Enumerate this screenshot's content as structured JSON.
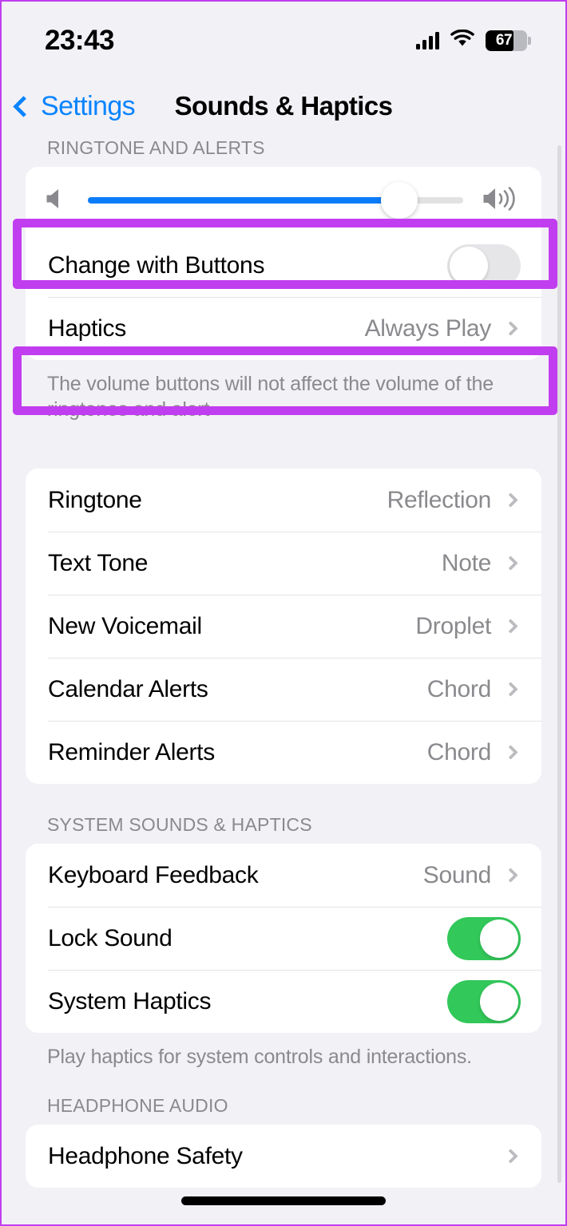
{
  "status_bar": {
    "time": "23:43",
    "battery_percent": "67",
    "signal_icon": "cellular-bars-icon",
    "wifi_icon": "wifi-icon",
    "battery_icon": "battery-icon"
  },
  "nav": {
    "back_label": "Settings",
    "title": "Sounds & Haptics"
  },
  "colors": {
    "accent_blue": "#0a84ff",
    "slider_blue": "#0a7cfa",
    "toggle_on_green": "#32c85a",
    "highlight_purple": "#c13ef0",
    "page_background": "#f2f1f6",
    "secondary_text": "#8a8a8e"
  },
  "sections": {
    "ringtone": {
      "header": "RINGTONE AND ALERTS",
      "volume_slider": {
        "name": "ringer-volume-slider",
        "value_percent": 83,
        "low_icon": "speaker-low-icon",
        "high_icon": "speaker-high-icon"
      },
      "change_with_buttons": {
        "label": "Change with Buttons",
        "toggle_state": "off"
      },
      "haptics": {
        "label": "Haptics",
        "value": "Always Play"
      },
      "footer": "The volume buttons will not affect the volume of the ringtones and alert"
    },
    "sounds": {
      "rows": [
        {
          "label": "Ringtone",
          "value": "Reflection"
        },
        {
          "label": "Text Tone",
          "value": "Note"
        },
        {
          "label": "New Voicemail",
          "value": "Droplet"
        },
        {
          "label": "Calendar Alerts",
          "value": "Chord"
        },
        {
          "label": "Reminder Alerts",
          "value": "Chord"
        }
      ]
    },
    "system": {
      "header": "SYSTEM SOUNDS & HAPTICS",
      "keyboard_feedback": {
        "label": "Keyboard Feedback",
        "value": "Sound"
      },
      "lock_sound": {
        "label": "Lock Sound",
        "toggle_state": "on"
      },
      "system_haptics": {
        "label": "System Haptics",
        "toggle_state": "on"
      },
      "footer": "Play haptics for system controls and interactions."
    },
    "headphone": {
      "header": "HEADPHONE AUDIO",
      "safety": {
        "label": "Headphone Safety"
      }
    }
  },
  "highlights": [
    {
      "name": "highlight-volume-slider"
    },
    {
      "name": "highlight-haptics-row"
    }
  ]
}
